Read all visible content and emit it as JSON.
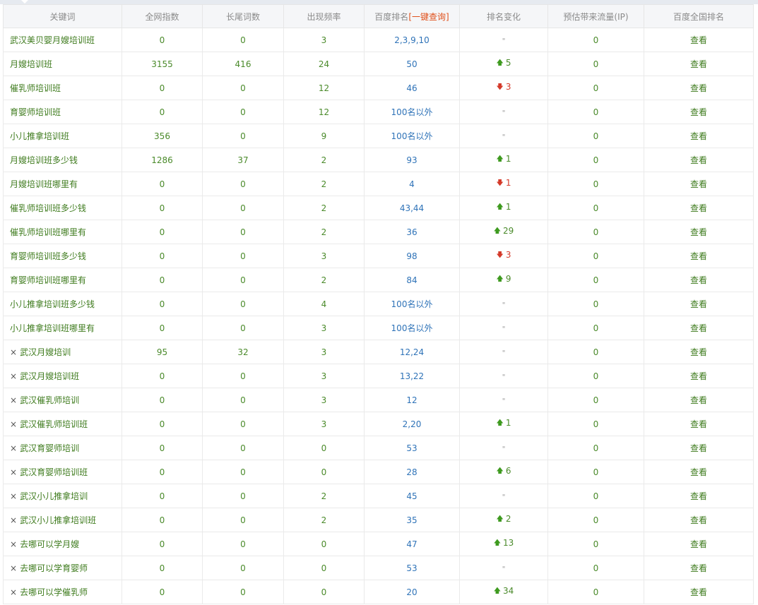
{
  "headers": {
    "keyword": "关键词",
    "index": "全网指数",
    "longtail": "长尾词数",
    "frequency": "出现频率",
    "rank_prefix": "百度排名",
    "rank_link": "[一键查询]",
    "change": "排名变化",
    "traffic": "预估带来流量(IP)",
    "national": "百度全国排名"
  },
  "view_label": "查看",
  "remove_mark": "×",
  "dash": "\"",
  "colors": {
    "up": "#3e9a1f",
    "down": "#d43a2a",
    "keyword": "#3e7b1d",
    "rank": "#2f73b8",
    "one_click": "#e0501b"
  },
  "rows": [
    {
      "keyword": "武汉美贝婴月嫂培训班",
      "removable": false,
      "index": "0",
      "longtail": "0",
      "frequency": "3",
      "rank": "2,3,9,10",
      "change_dir": "none",
      "change": "",
      "traffic": "0"
    },
    {
      "keyword": "月嫂培训班",
      "removable": false,
      "index": "3155",
      "longtail": "416",
      "frequency": "24",
      "rank": "50",
      "change_dir": "up",
      "change": "5",
      "traffic": "0"
    },
    {
      "keyword": "催乳师培训班",
      "removable": false,
      "index": "0",
      "longtail": "0",
      "frequency": "12",
      "rank": "46",
      "change_dir": "down",
      "change": "3",
      "traffic": "0"
    },
    {
      "keyword": "育婴师培训班",
      "removable": false,
      "index": "0",
      "longtail": "0",
      "frequency": "12",
      "rank": "100名以外",
      "change_dir": "none",
      "change": "",
      "traffic": "0"
    },
    {
      "keyword": "小儿推拿培训班",
      "removable": false,
      "index": "356",
      "longtail": "0",
      "frequency": "9",
      "rank": "100名以外",
      "change_dir": "none",
      "change": "",
      "traffic": "0"
    },
    {
      "keyword": "月嫂培训班多少钱",
      "removable": false,
      "index": "1286",
      "longtail": "37",
      "frequency": "2",
      "rank": "93",
      "change_dir": "up",
      "change": "1",
      "traffic": "0"
    },
    {
      "keyword": "月嫂培训班哪里有",
      "removable": false,
      "index": "0",
      "longtail": "0",
      "frequency": "2",
      "rank": "4",
      "change_dir": "down",
      "change": "1",
      "traffic": "0"
    },
    {
      "keyword": "催乳师培训班多少钱",
      "removable": false,
      "index": "0",
      "longtail": "0",
      "frequency": "2",
      "rank": "43,44",
      "change_dir": "up",
      "change": "1",
      "traffic": "0"
    },
    {
      "keyword": "催乳师培训班哪里有",
      "removable": false,
      "index": "0",
      "longtail": "0",
      "frequency": "2",
      "rank": "36",
      "change_dir": "up",
      "change": "29",
      "traffic": "0"
    },
    {
      "keyword": "育婴师培训班多少钱",
      "removable": false,
      "index": "0",
      "longtail": "0",
      "frequency": "3",
      "rank": "98",
      "change_dir": "down",
      "change": "3",
      "traffic": "0"
    },
    {
      "keyword": "育婴师培训班哪里有",
      "removable": false,
      "index": "0",
      "longtail": "0",
      "frequency": "2",
      "rank": "84",
      "change_dir": "up",
      "change": "9",
      "traffic": "0"
    },
    {
      "keyword": "小儿推拿培训班多少钱",
      "removable": false,
      "index": "0",
      "longtail": "0",
      "frequency": "4",
      "rank": "100名以外",
      "change_dir": "none",
      "change": "",
      "traffic": "0"
    },
    {
      "keyword": "小儿推拿培训班哪里有",
      "removable": false,
      "index": "0",
      "longtail": "0",
      "frequency": "3",
      "rank": "100名以外",
      "change_dir": "none",
      "change": "",
      "traffic": "0"
    },
    {
      "keyword": "武汉月嫂培训",
      "removable": true,
      "index": "95",
      "longtail": "32",
      "frequency": "3",
      "rank": "12,24",
      "change_dir": "none",
      "change": "",
      "traffic": "0"
    },
    {
      "keyword": "武汉月嫂培训班",
      "removable": true,
      "index": "0",
      "longtail": "0",
      "frequency": "3",
      "rank": "13,22",
      "change_dir": "none",
      "change": "",
      "traffic": "0"
    },
    {
      "keyword": "武汉催乳师培训",
      "removable": true,
      "index": "0",
      "longtail": "0",
      "frequency": "3",
      "rank": "12",
      "change_dir": "none",
      "change": "",
      "traffic": "0"
    },
    {
      "keyword": "武汉催乳师培训班",
      "removable": true,
      "index": "0",
      "longtail": "0",
      "frequency": "3",
      "rank": "2,20",
      "change_dir": "up",
      "change": "1",
      "traffic": "0"
    },
    {
      "keyword": "武汉育婴师培训",
      "removable": true,
      "index": "0",
      "longtail": "0",
      "frequency": "0",
      "rank": "53",
      "change_dir": "none",
      "change": "",
      "traffic": "0"
    },
    {
      "keyword": "武汉育婴师培训班",
      "removable": true,
      "index": "0",
      "longtail": "0",
      "frequency": "0",
      "rank": "28",
      "change_dir": "up",
      "change": "6",
      "traffic": "0"
    },
    {
      "keyword": "武汉小儿推拿培训",
      "removable": true,
      "index": "0",
      "longtail": "0",
      "frequency": "2",
      "rank": "45",
      "change_dir": "none",
      "change": "",
      "traffic": "0"
    },
    {
      "keyword": "武汉小儿推拿培训班",
      "removable": true,
      "index": "0",
      "longtail": "0",
      "frequency": "2",
      "rank": "35",
      "change_dir": "up",
      "change": "2",
      "traffic": "0"
    },
    {
      "keyword": "去哪可以学月嫂",
      "removable": true,
      "index": "0",
      "longtail": "0",
      "frequency": "0",
      "rank": "47",
      "change_dir": "up",
      "change": "13",
      "traffic": "0"
    },
    {
      "keyword": "去哪可以学育婴师",
      "removable": true,
      "index": "0",
      "longtail": "0",
      "frequency": "0",
      "rank": "53",
      "change_dir": "none",
      "change": "",
      "traffic": "0"
    },
    {
      "keyword": "去哪可以学催乳师",
      "removable": true,
      "index": "0",
      "longtail": "0",
      "frequency": "0",
      "rank": "20",
      "change_dir": "up",
      "change": "34",
      "traffic": "0"
    }
  ]
}
